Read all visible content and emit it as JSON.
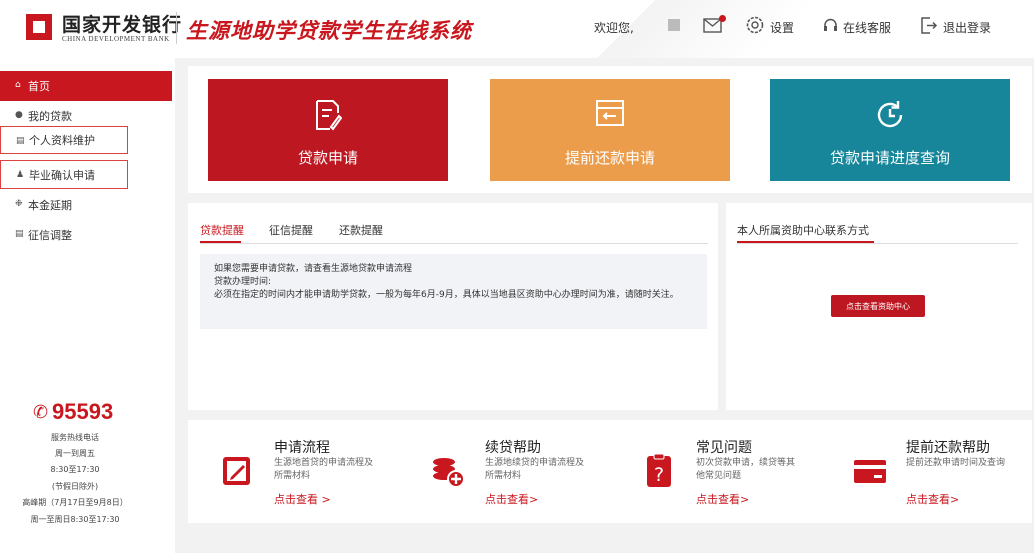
{
  "header": {
    "bank_name": "国家开发银行",
    "bank_name_en": "CHINA DEVELOPMENT BANK",
    "system_title": "生源地助学贷款学生在线系统",
    "welcome": "欢迎您,",
    "settings": "设置",
    "online_service": "在线客服",
    "logout": "退出登录",
    "accent": "#c8171e"
  },
  "sidebar": {
    "items": [
      {
        "label": "首页",
        "icon": "home-icon"
      },
      {
        "label": "我的贷款",
        "icon": "coin-icon"
      },
      {
        "label": "个人资料维护",
        "icon": "card-icon"
      },
      {
        "label": "毕业确认申请",
        "icon": "person-icon"
      },
      {
        "label": "本金延期",
        "icon": "gear-icon"
      },
      {
        "label": "征信调整",
        "icon": "list-icon"
      }
    ],
    "hotline": "95593",
    "hotline_lines": [
      "服务热线电话",
      "周一到周五",
      "8:30至17:30",
      "(节假日除外)",
      "高峰期（7月17日至9月8日）",
      "周一至周日8:30至17:30"
    ]
  },
  "cards": [
    {
      "label": "贷款申请",
      "color": "#bd1721",
      "icon": "document-edit-icon"
    },
    {
      "label": "提前还款申请",
      "color": "#eb9d4c",
      "icon": "repay-icon"
    },
    {
      "label": "贷款申请进度查询",
      "color": "#17869a",
      "icon": "clock-refresh-icon"
    }
  ],
  "tabs": [
    "贷款提醒",
    "征信提醒",
    "还款提醒"
  ],
  "notice": {
    "line1": "如果您需要申请贷款，请查看生源地贷款申请流程",
    "line2": "贷款办理时间:",
    "line3": "必须在指定的时间内才能申请助学贷款，一般为每年6月-9月，具体以当地县区资助中心办理时间为准，请随时关注。"
  },
  "contact": {
    "title": "本人所属资助中心联系方式",
    "button": "点击查看资助中心"
  },
  "help": [
    {
      "title": "申请流程",
      "desc": "生源地首贷的申请流程及所需材料",
      "link": "点击查看 >",
      "icon": "pencil-square-icon"
    },
    {
      "title": "续贷帮助",
      "desc": "生源地续贷的申请流程及所需材料",
      "link": "点击查看>",
      "icon": "coins-plus-icon"
    },
    {
      "title": "常见问题",
      "desc": "初次贷款申请，续贷等其他常见问题",
      "link": "点击查看>",
      "icon": "question-icon"
    },
    {
      "title": "提前还款帮助",
      "desc": "提前还款申请时间及查询",
      "link": "点击查看>",
      "icon": "credit-card-icon"
    }
  ]
}
